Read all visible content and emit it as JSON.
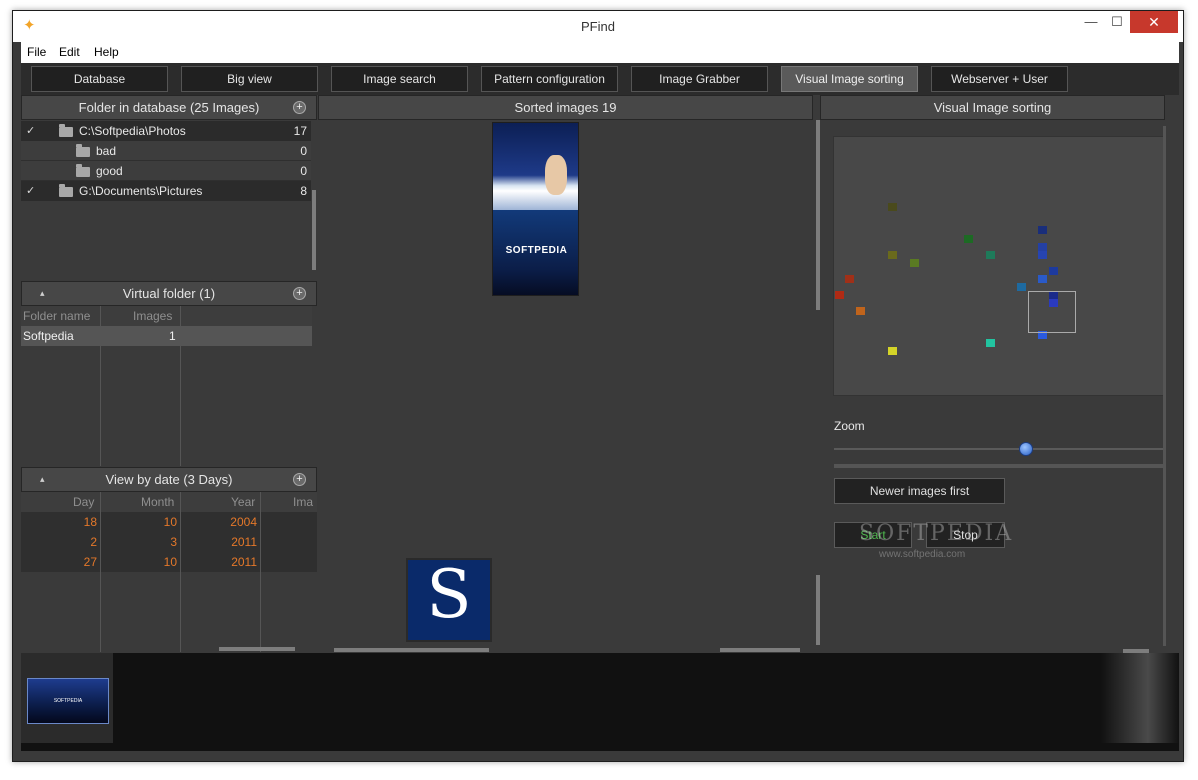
{
  "window": {
    "title": "PFind"
  },
  "menu": [
    "File",
    "Edit",
    "Help"
  ],
  "toolbar": {
    "buttons": [
      "Database",
      "Big view",
      "Image search",
      "Pattern configuration",
      "Image Grabber",
      "Visual Image sorting",
      "Webserver + User"
    ],
    "active": "Visual Image sorting"
  },
  "folders": {
    "title": "Folder in database (25 Images)",
    "rows": [
      {
        "label": "C:\\Softpedia\\Photos",
        "count": "17",
        "checked": true
      },
      {
        "label": "bad",
        "count": "0"
      },
      {
        "label": "good",
        "count": "0"
      },
      {
        "label": "G:\\Documents\\Pictures",
        "count": "8",
        "checked": true
      }
    ]
  },
  "virtual_folder": {
    "title": "Virtual folder (1)",
    "columns": [
      "Folder name",
      "Images"
    ],
    "rows": [
      {
        "name": "Softpedia",
        "images": "1"
      }
    ]
  },
  "view_by_date": {
    "title": "View by date (3 Days)",
    "columns": [
      "Day",
      "Month",
      "Year",
      "Ima"
    ],
    "rows": [
      {
        "day": "18",
        "month": "10",
        "year": "2004"
      },
      {
        "day": "2",
        "month": "3",
        "year": "2011"
      },
      {
        "day": "27",
        "month": "10",
        "year": "2011"
      }
    ]
  },
  "sorted_images": {
    "title": "Sorted images 19",
    "thumb_text": "SOFTPEDIA",
    "letter": "S"
  },
  "visual_sorting": {
    "title": "Visual Image sorting",
    "zoom_label": "Zoom",
    "zoom_level": 0.6,
    "newer_button": "Newer images first",
    "start_button": "Start",
    "stop_button": "Stop"
  },
  "watermark": {
    "line1": "SOFTPEDIA",
    "line2": "www.softpedia.com"
  },
  "filmstrip": {
    "thumb_text": "SOFTPEDIA"
  },
  "colors": {
    "accent_orange": "#e4782a",
    "active_button": "#5a5a5a",
    "close_red": "#c7382c"
  }
}
